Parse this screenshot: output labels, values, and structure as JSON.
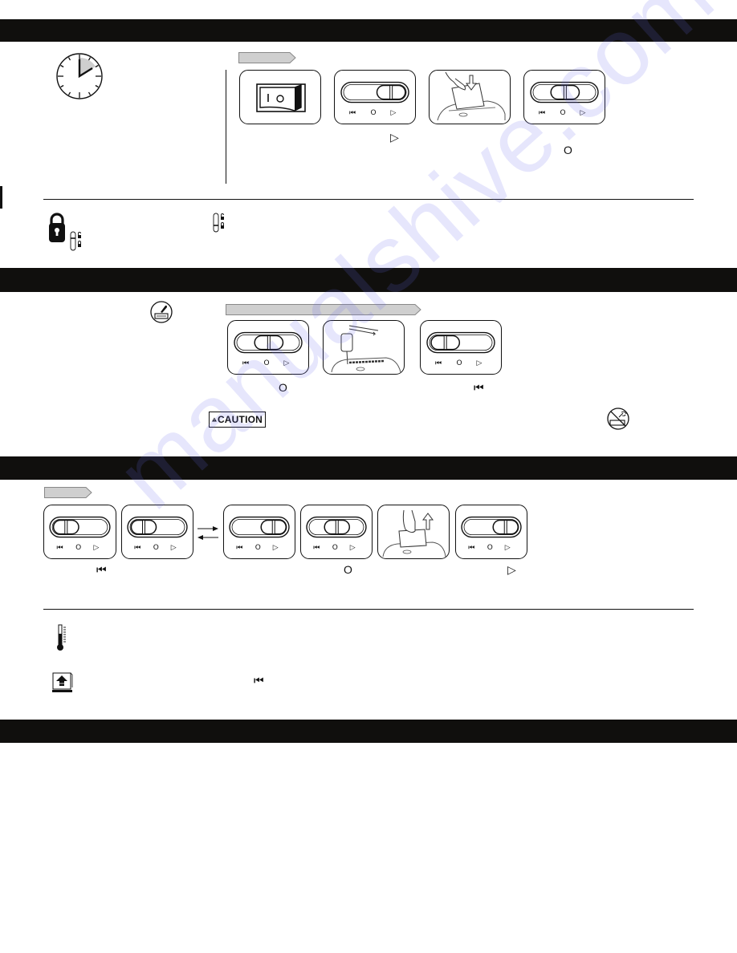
{
  "document": {
    "type": "shredder-operation-manual-page",
    "section_bars": 4
  },
  "slider_labels": {
    "reverse": "⏮",
    "off": "O",
    "auto": "▷"
  },
  "section_1_operation": {
    "clock_icon": "clock-icon",
    "step_tag": "",
    "panels": [
      {
        "kind": "rocker-switch",
        "icon": "power-switch-icon",
        "switch_labels": [
          "I",
          "O"
        ]
      },
      {
        "kind": "slider",
        "position": "auto",
        "caption": "▷"
      },
      {
        "kind": "illustration",
        "icon": "insert-paper-icon"
      },
      {
        "kind": "slider",
        "position": "off",
        "caption": "O"
      }
    ]
  },
  "section_1_lock": {
    "lock_icon": "padlock-icon",
    "lock_switch_states": [
      "unlocked",
      "locked"
    ]
  },
  "section_2_oiling": {
    "oil_icon": "oil-shredder-icon",
    "panels": [
      {
        "kind": "slider",
        "position": "off",
        "caption": "O"
      },
      {
        "kind": "illustration",
        "icon": "oil-cutters-icon"
      },
      {
        "kind": "slider",
        "position": "reverse",
        "caption": "⏮"
      }
    ],
    "caution_label": "CAUTION",
    "no_aerosol_icon": "no-aerosol-icon"
  },
  "section_3_jam": {
    "panels": [
      {
        "kind": "slider",
        "position": "reverse",
        "caption": "⏮"
      },
      {
        "kind": "slider",
        "position": "reverse",
        "caption": ""
      },
      {
        "kind": "slider",
        "position": "auto",
        "caption": ""
      },
      {
        "kind": "slider",
        "position": "off",
        "caption": "O"
      },
      {
        "kind": "illustration",
        "icon": "remove-paper-icon"
      },
      {
        "kind": "slider",
        "position": "auto",
        "caption": "▷"
      }
    ],
    "alternate_arrows": "⇄"
  },
  "section_3_notes": {
    "thermometer_icon": "thermometer-icon",
    "bin_full_icon": "bin-full-icon",
    "bin_full_caption": "⏮"
  },
  "watermark": "manualshive.com"
}
